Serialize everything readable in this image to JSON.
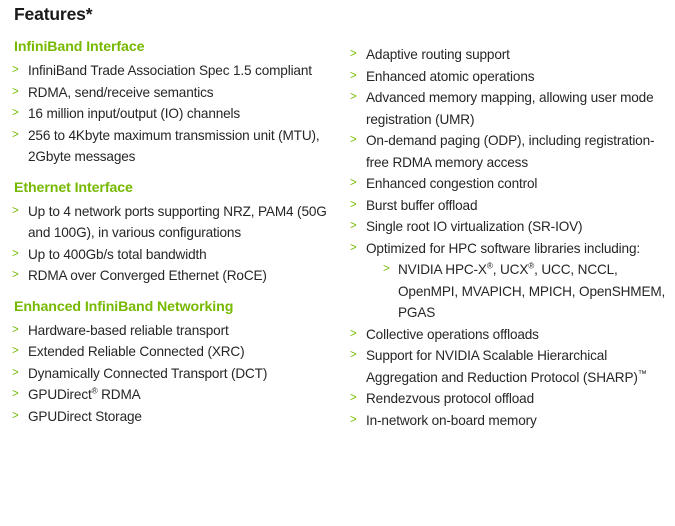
{
  "header": {
    "title": "Features*"
  },
  "colors": {
    "accent_green": "#76b900",
    "body_text": "#262626",
    "title_text": "#1a1a1a",
    "background": "#ffffff"
  },
  "bullet_glyph": ">",
  "left_column": {
    "sections": [
      {
        "heading": "InfiniBand Interface",
        "items": [
          "InfiniBand Trade Association Spec 1.5 compliant",
          "RDMA, send/receive semantics",
          "16 million input/output (IO) channels",
          "256 to 4Kbyte maximum transmission unit (MTU), 2Gbyte messages"
        ]
      },
      {
        "heading": "Ethernet Interface",
        "items": [
          "Up to 4 network ports supporting NRZ, PAM4 (50G and 100G), in various configurations",
          "Up to 400Gb/s total bandwidth",
          "RDMA over Converged Ethernet (RoCE)"
        ]
      },
      {
        "heading": "Enhanced InfiniBand Networking",
        "items": [
          "Hardware-based reliable transport",
          "Extended Reliable Connected (XRC)",
          "Dynamically Connected Transport (DCT)",
          "GPUDirect® RDMA",
          "GPUDirect Storage"
        ]
      }
    ]
  },
  "right_column": {
    "items": [
      "Adaptive routing support",
      "Enhanced atomic operations",
      "Advanced memory mapping, allowing user mode registration (UMR)",
      "On-demand paging (ODP), including registration-free RDMA memory access",
      "Enhanced congestion control",
      "Burst buffer offload",
      "Single root IO virtualization (SR-IOV)",
      "Optimized for HPC software libraries including:",
      "Collective operations offloads",
      "Support for NVIDIA Scalable Hierarchical Aggregation and Reduction Protocol (SHARP)™",
      "Rendezvous protocol offload",
      "In-network on-board memory"
    ],
    "sub_items": [
      "NVIDIA HPC-X®, UCX®, UCC, NCCL, OpenMPI, MVAPICH, MPICH, OpenSHMEM, PGAS"
    ]
  }
}
